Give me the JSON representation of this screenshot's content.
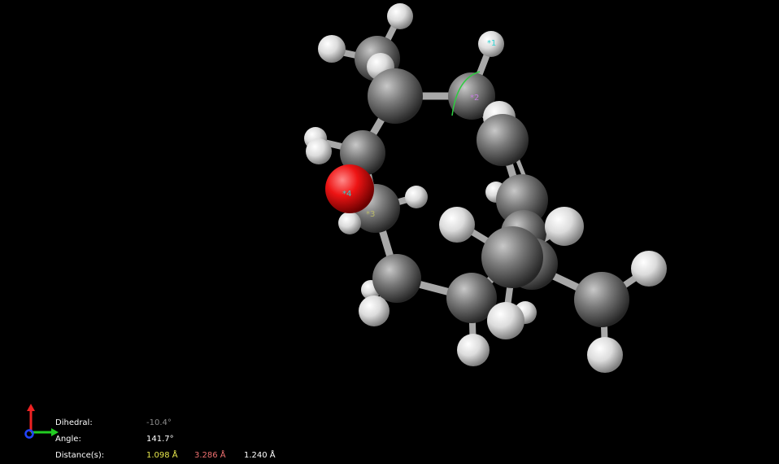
{
  "viewer": {
    "background_color": "#000000",
    "atom_colors": {
      "carbon": "#7f7f7f",
      "hydrogen": "#ebebeb",
      "oxygen": "#ff1010"
    },
    "selection_arc_color": "#2ecc40"
  },
  "atom_labels": {
    "a1": "*1",
    "a2": "*2",
    "a3": "*3",
    "a4": "*4"
  },
  "atom_label_colors": {
    "a1": "#2fd2d2",
    "a2": "#c77ee0",
    "a3": "#b8b86a",
    "a4": "#2fd2d2"
  },
  "measurements": {
    "dihedral_label": "Dihedral:",
    "dihedral_value": "-10.4°",
    "dihedral_color": "#8c8c8c",
    "angle_label": "Angle:",
    "angle_value": "141.7°",
    "angle_color": "#ffffff",
    "distance_label": "Distance(s):",
    "distances": [
      {
        "value": "1.098 Å",
        "color": "#e6e64c"
      },
      {
        "value": "3.286 Å",
        "color": "#ee6f6f"
      },
      {
        "value": "1.240 Å",
        "color": "#ffffff"
      }
    ]
  },
  "axes_triad": {
    "x_color": "#22cc22",
    "y_color": "#ee2222",
    "z_color": "#2244ff"
  }
}
